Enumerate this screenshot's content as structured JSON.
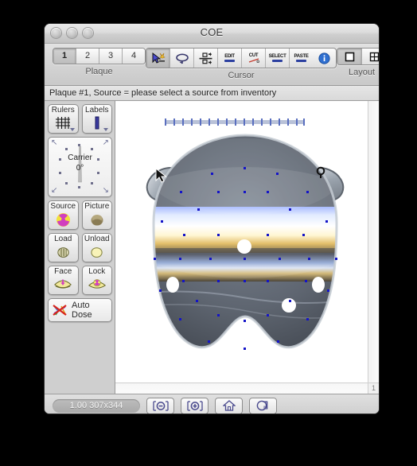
{
  "window": {
    "title": "COE",
    "traffic_lights": [
      "close-button",
      "minimize-button",
      "zoom-button"
    ]
  },
  "toolbar": {
    "plaque": {
      "label": "Plaque",
      "tabs": [
        "1",
        "2",
        "3",
        "4"
      ],
      "selected": "1"
    },
    "cursor": {
      "label": "Cursor",
      "buttons": [
        {
          "name": "select-pointer-tool",
          "label": "",
          "selected": true
        },
        {
          "name": "rotate-tool",
          "label": ""
        },
        {
          "name": "move-adjust-tool",
          "label": ""
        },
        {
          "name": "edit-tool",
          "label": "EDIT"
        },
        {
          "name": "cut-tool",
          "label": "CUT"
        },
        {
          "name": "select-tool",
          "label": "SELECT"
        },
        {
          "name": "paste-tool",
          "label": "PASTE"
        },
        {
          "name": "info-tool",
          "label": ""
        }
      ]
    },
    "layout": {
      "label": "Layout",
      "options": [
        "single-pane",
        "quad-pane"
      ],
      "selected": "single-pane"
    }
  },
  "status": {
    "text": "Plaque #1, Source = please select a source from inventory"
  },
  "sidebar": {
    "rulers": {
      "label": "Rulers",
      "icon": "grid-icon"
    },
    "labels": {
      "label": "Labels",
      "icon": "label-bar-icon"
    },
    "carrier": {
      "title": "Carrier",
      "angle": "0°"
    },
    "source": {
      "label": "Source",
      "icon": "radiation-icon"
    },
    "picture": {
      "label": "Picture",
      "icon": "eye-globe-icon"
    },
    "load": {
      "label": "Load",
      "icon": "load-disc-icon"
    },
    "unload": {
      "label": "Unload",
      "icon": "unload-disc-icon"
    },
    "face": {
      "label": "Face",
      "icon": "face-plaque-icon"
    },
    "lock": {
      "label": "Lock",
      "icon": "lock-plaque-icon"
    },
    "auto_dose": {
      "label": "Auto Dose",
      "icon": "no-dose-icon"
    }
  },
  "canvas": {
    "page_number": "1",
    "ruler_ticks": 16
  },
  "bottombar": {
    "zoom_info": "1.00 307x344",
    "buttons": [
      {
        "name": "zoom-out-button",
        "icon": "zoom-out-icon"
      },
      {
        "name": "zoom-in-button",
        "icon": "zoom-in-icon"
      },
      {
        "name": "home-view-button",
        "icon": "home-icon"
      },
      {
        "name": "duplicate-view-button",
        "icon": "copy-icon"
      }
    ]
  },
  "colors": {
    "marker": "#1414c8",
    "ruler_tick": "#5a6fbf",
    "accent": "#2b3fa0"
  }
}
